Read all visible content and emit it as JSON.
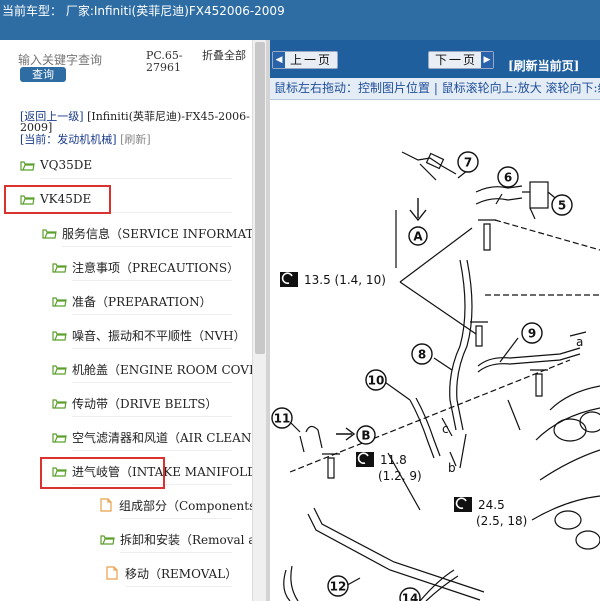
{
  "header": {
    "text": "当前车型：  厂家:Infiniti(英菲尼迪)FX452006-2009"
  },
  "sidebar": {
    "search_placeholder": "输入关键字查询",
    "search_button": "查询",
    "pc_code_line1": "PC.65-",
    "pc_code_line2": "27961",
    "fold_all": "折叠全部",
    "back_label": "[返回上一级]",
    "back_path": " [Infiniti(英菲尼迪)-FX45-2006-2009]",
    "current_label": "[当前：发动机机械]",
    "refresh_label": "[刷新]",
    "items": [
      {
        "label": "VQ35DE",
        "icon": "folder-open-icon"
      },
      {
        "label": "VK45DE",
        "icon": "folder-open-icon"
      },
      {
        "label": "服务信息（SERVICE INFORMATION）",
        "icon": "folder-open-icon"
      },
      {
        "label": "注意事项（PRECAUTIONS）",
        "icon": "folder-open-icon"
      },
      {
        "label": "准备（PREPARATION）",
        "icon": "folder-open-icon"
      },
      {
        "label": "噪音、振动和不平顺性（NVH）",
        "icon": "folder-open-icon"
      },
      {
        "label": "机舱盖（ENGINE ROOM COVER）",
        "icon": "folder-open-icon"
      },
      {
        "label": "传动带（DRIVE BELTS）",
        "icon": "folder-open-icon"
      },
      {
        "label": "空气滤清器和风道（AIR CLEANER）",
        "icon": "folder-open-icon"
      },
      {
        "label": "进气岐管（INTAKE MANIFOLD）",
        "icon": "folder-open-icon"
      },
      {
        "label": "组成部分（Components）",
        "icon": "document-icon"
      },
      {
        "label": "拆卸和安装（Removal and Installation）",
        "icon": "folder-open-icon"
      },
      {
        "label": "移动（REMOVAL）",
        "icon": "document-icon"
      }
    ]
  },
  "viewer": {
    "prev_button": "上一页",
    "next_button": "下一页",
    "refresh_button": "[刷新当前页]",
    "hint": "鼠标左右拖动：控制图片位置 | 鼠标滚轮向上:放大  滚轮向下:缩小",
    "callouts": [
      "7",
      "6",
      "5",
      "8",
      "9",
      "10",
      "11",
      "12",
      "14"
    ],
    "letters": [
      "A",
      "B",
      "a",
      "c",
      "b"
    ],
    "torque": [
      {
        "value": "13.5 (1.4, 10)"
      },
      {
        "value": "11.8",
        "sub": "(1.2, 9)"
      },
      {
        "value": "24.5",
        "sub": "(2.5, 18)"
      }
    ]
  },
  "colors": {
    "brand_blue": "#2e6da4",
    "highlight_red": "#d9322f",
    "folder_green": "#5aa02c",
    "document_orange": "#e8a04a"
  }
}
